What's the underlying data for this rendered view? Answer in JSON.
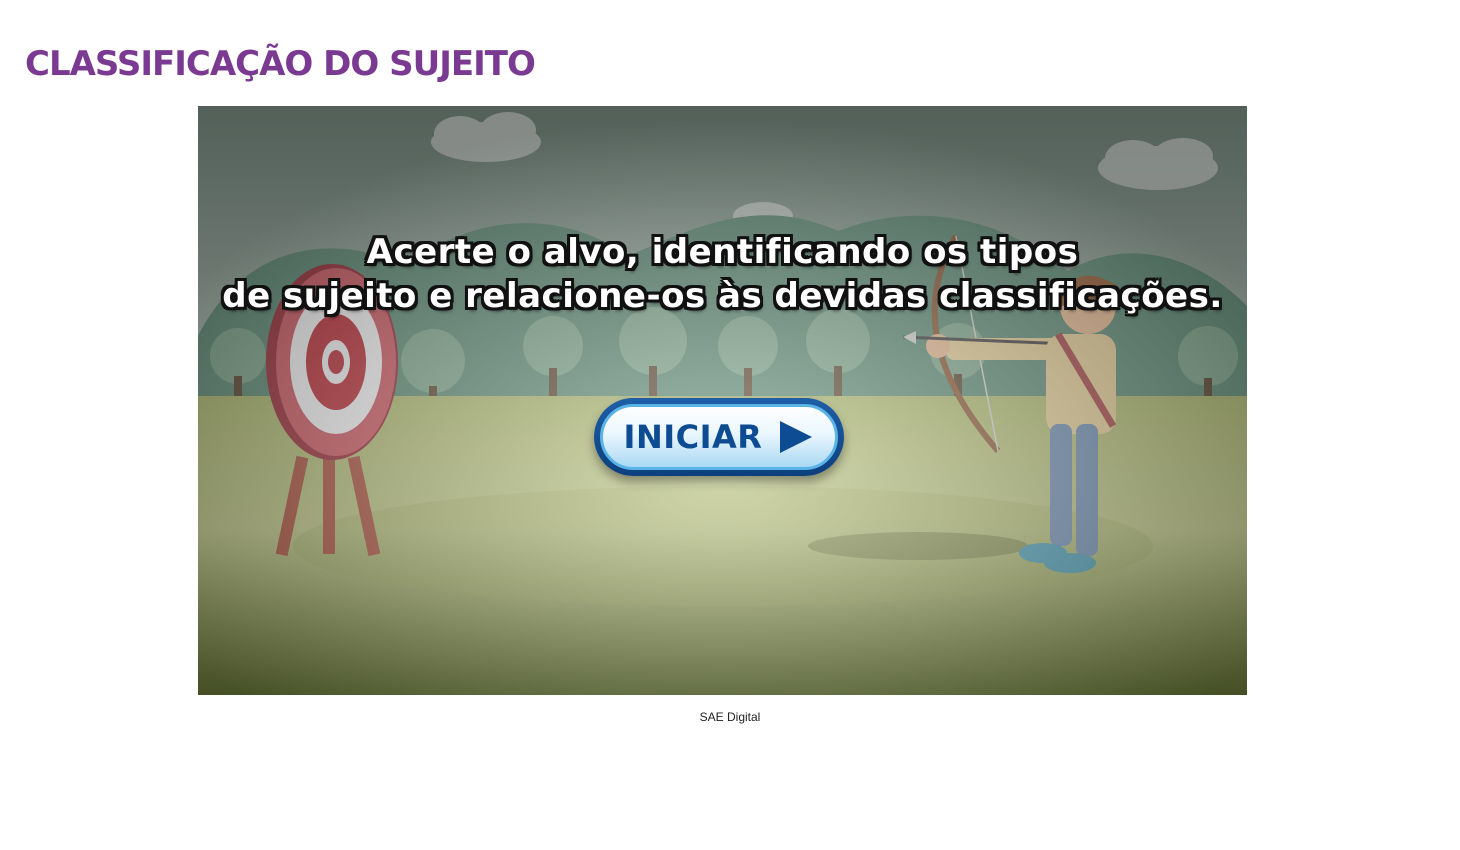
{
  "page": {
    "title": "CLASSIFICAÇÃO DO SUJEITO",
    "title_color": "#7b3a91"
  },
  "game": {
    "instructions_line1": "Acerte o alvo, identificando os tipos",
    "instructions_line2": "de sujeito e relacione-os às devidas classificações.",
    "start_button_label": "INICIAR",
    "start_icon": "play-arrow-icon",
    "scene": [
      "sky",
      "clouds",
      "hills",
      "trees",
      "archery-target",
      "archer-with-bow"
    ],
    "target_colors": [
      "#c8434b",
      "#ffffff"
    ]
  },
  "footer": {
    "credit": "SAE Digital"
  }
}
